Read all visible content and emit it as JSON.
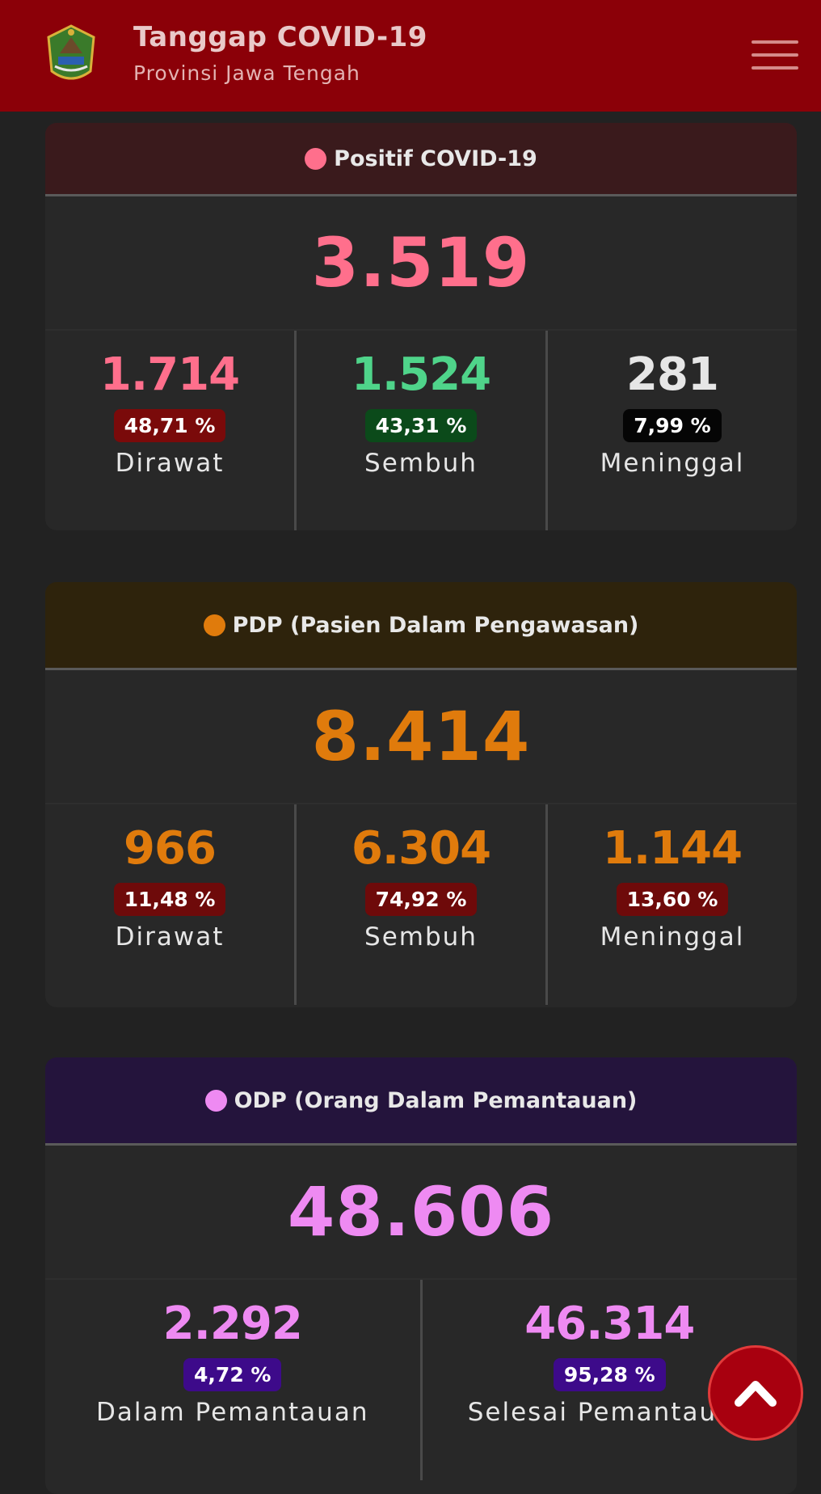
{
  "header": {
    "title": "Tanggap COVID-19",
    "subtitle": "Provinsi Jawa Tengah"
  },
  "positif": {
    "title": "Positif COVID-19",
    "total": "3.519",
    "accent": "#ff6f8c",
    "stats": [
      {
        "value": "1.714",
        "percent": "48,71 %",
        "label": "Dirawat",
        "value_color": "#ff6f8c",
        "badge_color": "#7a0a0a"
      },
      {
        "value": "1.524",
        "percent": "43,31 %",
        "label": "Sembuh",
        "value_color": "#4fd48a",
        "badge_color": "#0b4a1a"
      },
      {
        "value": "281",
        "percent": "7,99 %",
        "label": "Meninggal",
        "value_color": "#e6e6e6",
        "badge_color": "#050505"
      }
    ]
  },
  "pdp": {
    "title": "PDP (Pasien Dalam Pengawasan)",
    "total": "8.414",
    "accent": "#e07b0c",
    "stats": [
      {
        "value": "966",
        "percent": "11,48 %",
        "label": "Dirawat",
        "value_color": "#e07b0c",
        "badge_color": "#6e0a0a"
      },
      {
        "value": "6.304",
        "percent": "74,92 %",
        "label": "Sembuh",
        "value_color": "#e07b0c",
        "badge_color": "#6e0a0a"
      },
      {
        "value": "1.144",
        "percent": "13,60 %",
        "label": "Meninggal",
        "value_color": "#e07b0c",
        "badge_color": "#6e0a0a"
      }
    ]
  },
  "odp": {
    "title": "ODP (Orang Dalam Pemantauan)",
    "total": "48.606",
    "accent": "#ee8af2",
    "stats": [
      {
        "value": "2.292",
        "percent": "4,72 %",
        "label": "Dalam Pemantauan",
        "value_color": "#ee8af2",
        "badge_color": "#3d0a8a"
      },
      {
        "value": "46.314",
        "percent": "95,28 %",
        "label": "Selesai Pemantauan",
        "value_color": "#ee8af2",
        "badge_color": "#3d0a8a"
      }
    ]
  },
  "icons": {
    "logo": "jawa-tengah-emblem",
    "menu": "hamburger-menu-icon",
    "scroll_top": "chevron-up-icon"
  }
}
